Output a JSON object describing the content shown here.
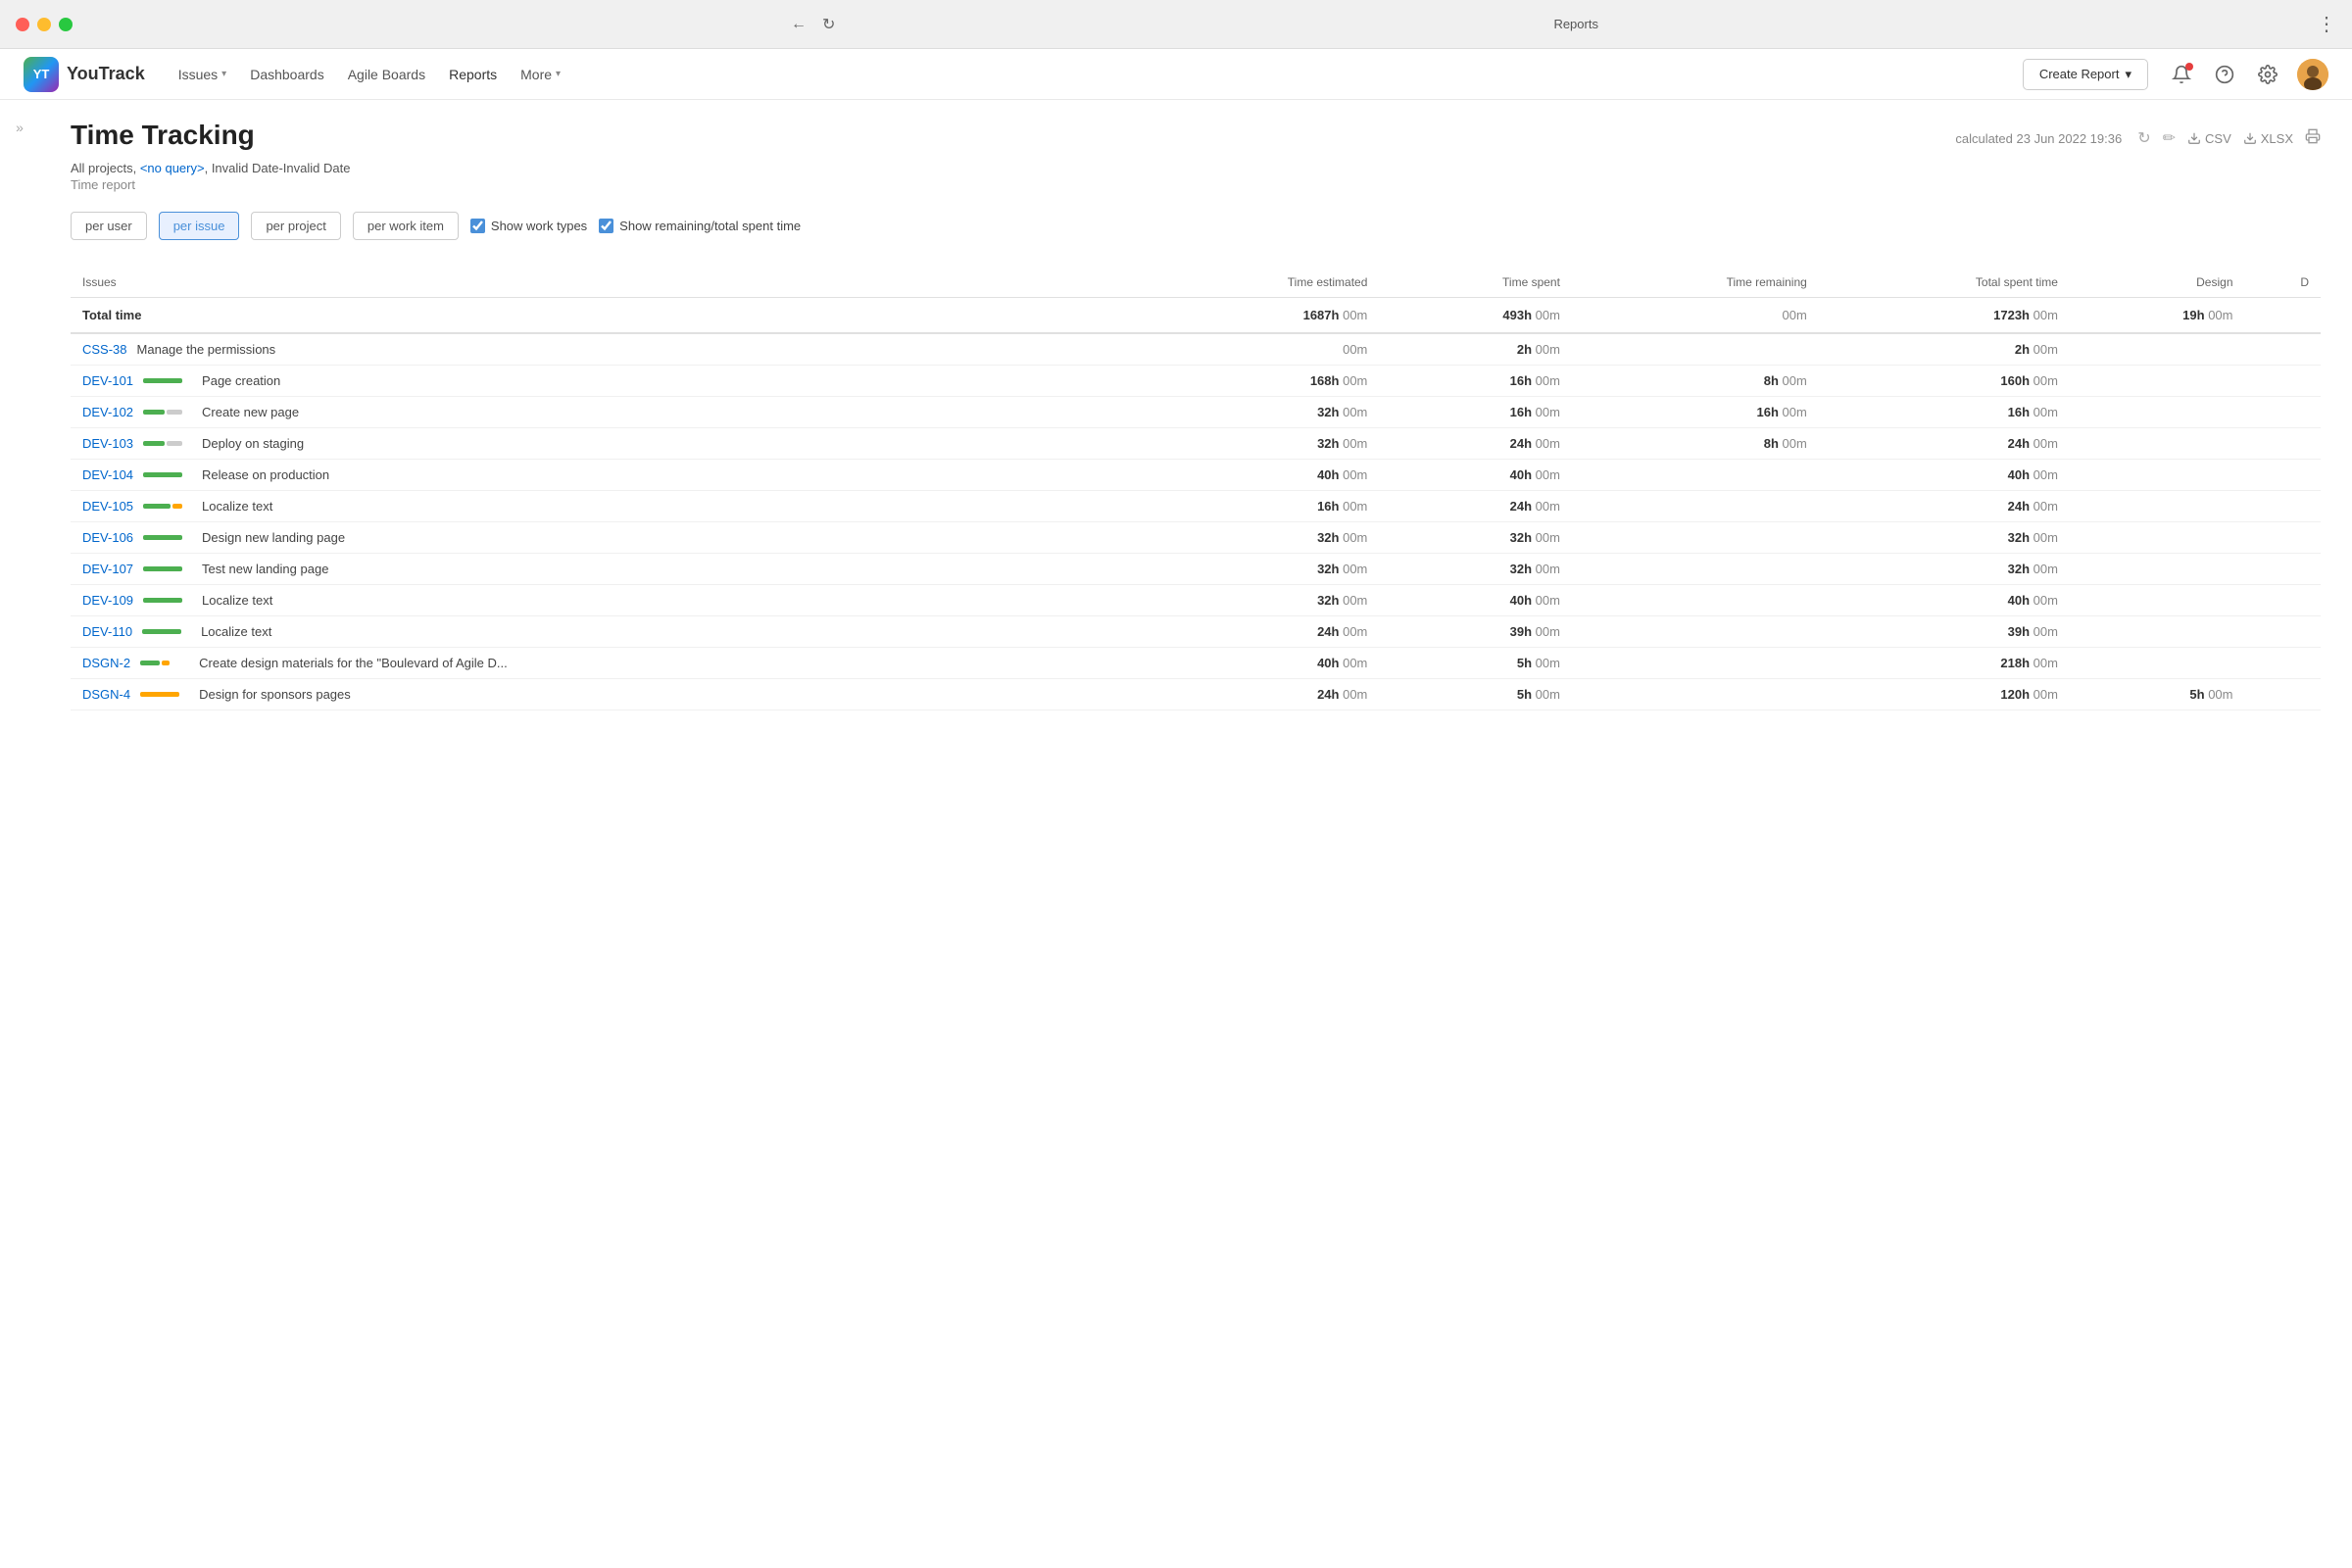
{
  "window": {
    "title": "Reports",
    "controls": {
      "close": "close",
      "minimize": "minimize",
      "maximize": "maximize"
    }
  },
  "nav": {
    "logo": {
      "abbr": "YT",
      "name": "YouTrack"
    },
    "items": [
      {
        "label": "Issues",
        "hasChevron": true,
        "active": false
      },
      {
        "label": "Dashboards",
        "hasChevron": false,
        "active": false
      },
      {
        "label": "Agile Boards",
        "hasChevron": false,
        "active": false
      },
      {
        "label": "Reports",
        "hasChevron": false,
        "active": true
      },
      {
        "label": "More",
        "hasChevron": true,
        "active": false
      }
    ],
    "createReport": "Create Report",
    "icons": [
      "bell",
      "question",
      "settings",
      "avatar"
    ]
  },
  "page": {
    "title": "Time Tracking",
    "calculated": "calculated 23 Jun 2022 19:36",
    "subtitle": "All projects, <no query>, Invalid Date-Invalid Date",
    "reportType": "Time report",
    "noQueryLink": "<no query>"
  },
  "actions": {
    "refresh": "↻",
    "edit": "✏",
    "csv": "CSV",
    "xlsx": "XLSX",
    "print": "⎙"
  },
  "controls": {
    "viewButtons": [
      {
        "label": "per user",
        "active": false
      },
      {
        "label": "per issue",
        "active": true
      },
      {
        "label": "per project",
        "active": false
      },
      {
        "label": "per work item",
        "active": false
      }
    ],
    "checkboxes": [
      {
        "label": "Show work types",
        "checked": true
      },
      {
        "label": "Show remaining/total spent time",
        "checked": true
      }
    ]
  },
  "table": {
    "columns": [
      "Issues",
      "Time estimated",
      "Time spent",
      "Time remaining",
      "Total spent time",
      "Design",
      "D"
    ],
    "totalRow": {
      "label": "Total time",
      "timeEstimated": {
        "bold": "1687h",
        "normal": "00m"
      },
      "timeSpent": {
        "bold": "493h",
        "normal": "00m"
      },
      "timeRemaining": {
        "bold": "",
        "normal": "00m"
      },
      "totalSpent": {
        "bold": "1723h",
        "normal": "00m"
      },
      "design": {
        "bold": "19h",
        "normal": "00m"
      }
    },
    "rows": [
      {
        "id": "CSS-38",
        "name": "Manage the permissions",
        "progress": null,
        "timeEstimated": {
          "bold": "",
          "normal": "00m"
        },
        "timeSpent": {
          "bold": "2h",
          "normal": "00m"
        },
        "timeRemaining": "",
        "totalSpent": {
          "bold": "2h",
          "normal": "00m"
        },
        "design": ""
      },
      {
        "id": "DEV-101",
        "name": "Page creation",
        "progress": {
          "type": "green-full"
        },
        "timeEstimated": {
          "bold": "168h",
          "normal": "00m"
        },
        "timeSpent": {
          "bold": "16h",
          "normal": "00m"
        },
        "timeRemaining": {
          "bold": "8h",
          "normal": "00m"
        },
        "totalSpent": {
          "bold": "160h",
          "normal": "00m"
        },
        "design": ""
      },
      {
        "id": "DEV-102",
        "name": "Create new page",
        "progress": {
          "type": "green-gray"
        },
        "timeEstimated": {
          "bold": "32h",
          "normal": "00m"
        },
        "timeSpent": {
          "bold": "16h",
          "normal": "00m"
        },
        "timeRemaining": {
          "bold": "16h",
          "normal": "00m"
        },
        "totalSpent": {
          "bold": "16h",
          "normal": "00m"
        },
        "design": ""
      },
      {
        "id": "DEV-103",
        "name": "Deploy on staging",
        "progress": {
          "type": "green-gray"
        },
        "timeEstimated": {
          "bold": "32h",
          "normal": "00m"
        },
        "timeSpent": {
          "bold": "24h",
          "normal": "00m"
        },
        "timeRemaining": {
          "bold": "8h",
          "normal": "00m"
        },
        "totalSpent": {
          "bold": "24h",
          "normal": "00m"
        },
        "design": ""
      },
      {
        "id": "DEV-104",
        "name": "Release on production",
        "progress": {
          "type": "green-full"
        },
        "timeEstimated": {
          "bold": "40h",
          "normal": "00m"
        },
        "timeSpent": {
          "bold": "40h",
          "normal": "00m"
        },
        "timeRemaining": "",
        "totalSpent": {
          "bold": "40h",
          "normal": "00m"
        },
        "design": ""
      },
      {
        "id": "DEV-105",
        "name": "Localize text",
        "progress": {
          "type": "green-orange"
        },
        "timeEstimated": {
          "bold": "16h",
          "normal": "00m"
        },
        "timeSpent": {
          "bold": "24h",
          "normal": "00m"
        },
        "timeRemaining": "",
        "totalSpent": {
          "bold": "24h",
          "normal": "00m"
        },
        "design": ""
      },
      {
        "id": "DEV-106",
        "name": "Design new landing page",
        "progress": {
          "type": "green-full"
        },
        "timeEstimated": {
          "bold": "32h",
          "normal": "00m"
        },
        "timeSpent": {
          "bold": "32h",
          "normal": "00m"
        },
        "timeRemaining": "",
        "totalSpent": {
          "bold": "32h",
          "normal": "00m"
        },
        "design": ""
      },
      {
        "id": "DEV-107",
        "name": "Test new landing page",
        "progress": {
          "type": "green-full"
        },
        "timeEstimated": {
          "bold": "32h",
          "normal": "00m"
        },
        "timeSpent": {
          "bold": "32h",
          "normal": "00m"
        },
        "timeRemaining": "",
        "totalSpent": {
          "bold": "32h",
          "normal": "00m"
        },
        "design": ""
      },
      {
        "id": "DEV-109",
        "name": "Localize text",
        "progress": {
          "type": "green-full"
        },
        "timeEstimated": {
          "bold": "32h",
          "normal": "00m"
        },
        "timeSpent": {
          "bold": "40h",
          "normal": "00m"
        },
        "timeRemaining": "",
        "totalSpent": {
          "bold": "40h",
          "normal": "00m"
        },
        "design": ""
      },
      {
        "id": "DEV-110",
        "name": "Localize text",
        "progress": {
          "type": "green-full"
        },
        "timeEstimated": {
          "bold": "24h",
          "normal": "00m"
        },
        "timeSpent": {
          "bold": "39h",
          "normal": "00m"
        },
        "timeRemaining": "",
        "totalSpent": {
          "bold": "39h",
          "normal": "00m"
        },
        "design": ""
      },
      {
        "id": "DSGN-2",
        "name": "Create design materials for the \"Boulevard of Agile D...",
        "progress": {
          "type": "green-orange-short"
        },
        "timeEstimated": {
          "bold": "40h",
          "normal": "00m"
        },
        "timeSpent": {
          "bold": "5h",
          "normal": "00m"
        },
        "timeRemaining": "",
        "totalSpent": {
          "bold": "218h",
          "normal": "00m"
        },
        "design": ""
      },
      {
        "id": "DSGN-4",
        "name": "Design for sponsors pages",
        "progress": {
          "type": "orange-full"
        },
        "timeEstimated": {
          "bold": "24h",
          "normal": "00m"
        },
        "timeSpent": {
          "bold": "5h",
          "normal": "00m"
        },
        "timeRemaining": "",
        "totalSpent": {
          "bold": "120h",
          "normal": "00m"
        },
        "design": {
          "bold": "5h",
          "normal": "00m"
        }
      }
    ]
  }
}
